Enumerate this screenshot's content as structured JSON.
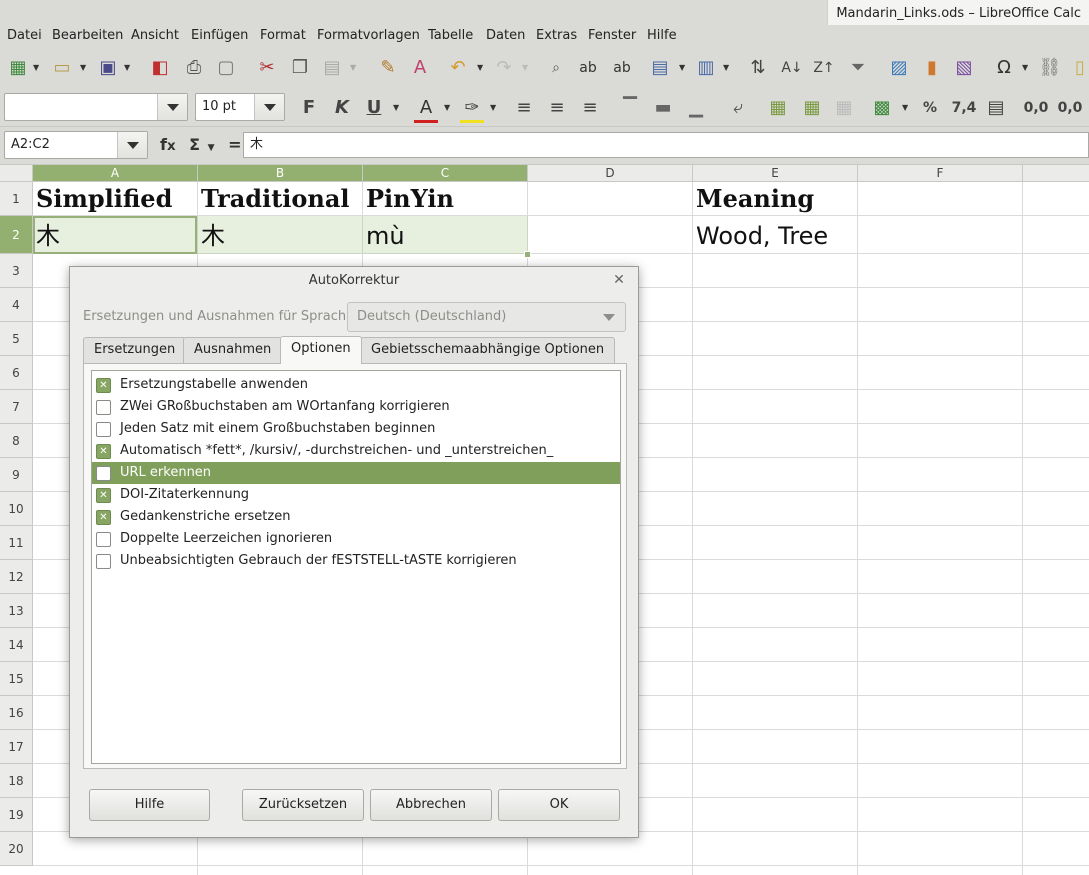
{
  "window": {
    "title": "Mandarin_Links.ods – LibreOffice Calc"
  },
  "menu": [
    "Datei",
    "Bearbeiten",
    "Ansicht",
    "Einfügen",
    "Format",
    "Formatvorlagen",
    "Tabelle",
    "Daten",
    "Extras",
    "Fenster",
    "Hilfe"
  ],
  "toolbar2": {
    "font_name": "",
    "font_size": "10 pt",
    "percent": "%",
    "number": "7,4",
    "dec_add": "0,0",
    "dec_del": "0,0"
  },
  "formula_bar": {
    "name_box": "A2:C2",
    "content": "木"
  },
  "columns": [
    "A",
    "B",
    "C",
    "D",
    "E",
    "F"
  ],
  "rows": [
    "1",
    "2",
    "3",
    "4",
    "5",
    "6",
    "7",
    "8",
    "9",
    "10",
    "11",
    "12",
    "13",
    "14",
    "15",
    "16",
    "17",
    "18",
    "19",
    "20"
  ],
  "cells": {
    "a1": "Simplified",
    "b1": "Traditional",
    "c1": "PinYin",
    "e1": "Meaning",
    "a2": "木",
    "b2": "木",
    "c2": "mù",
    "e2": "Wood, Tree"
  },
  "dialog": {
    "title": "AutoKorrektur",
    "lang_label": "Ersetzungen und Ausnahmen für Sprache:",
    "lang_value": "Deutsch (Deutschland)",
    "tabs": [
      "Ersetzungen",
      "Ausnahmen",
      "Optionen",
      "Gebietsschemaabhängige Optionen"
    ],
    "active_tab": "Optionen",
    "options": [
      {
        "label": "Ersetzungstabelle anwenden",
        "checked": true
      },
      {
        "label": "ZWei GRoßbuchstaben am WOrtanfang korrigieren",
        "checked": false
      },
      {
        "label": "Jeden Satz mit einem Großbuchstaben beginnen",
        "checked": false
      },
      {
        "label": "Automatisch *fett*, /kursiv/, -durchstreichen- und _unterstreichen_",
        "checked": true
      },
      {
        "label": "URL erkennen",
        "checked": false,
        "selected": true
      },
      {
        "label": "DOI-Zitaterkennung",
        "checked": true
      },
      {
        "label": "Gedankenstriche ersetzen",
        "checked": true
      },
      {
        "label": "Doppelte Leerzeichen ignorieren",
        "checked": false
      },
      {
        "label": "Unbeabsichtigten Gebrauch der fESTSTELL-tASTE korrigieren",
        "checked": false
      }
    ],
    "buttons": {
      "help": "Hilfe",
      "reset": "Zurücksetzen",
      "cancel": "Abbrechen",
      "ok": "OK"
    }
  },
  "colors": {
    "accent": "#7f9f5b",
    "selection_header": "#94b070",
    "chrome": "#dadad6"
  }
}
